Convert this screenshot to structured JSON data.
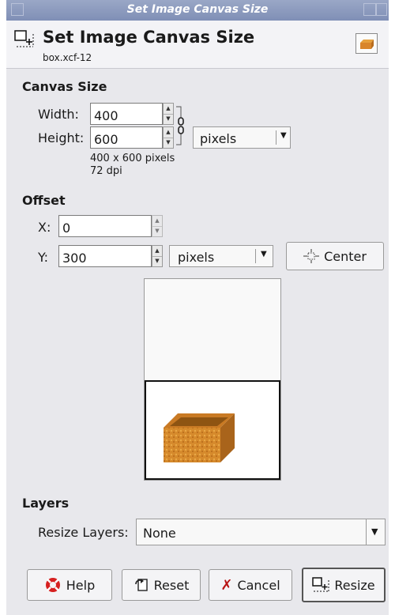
{
  "window": {
    "title": "Set Image Canvas Size"
  },
  "header": {
    "title": "Set Image Canvas Size",
    "subtitle": "box.xcf-12"
  },
  "canvas_size": {
    "section_label": "Canvas Size",
    "width_label": "Width:",
    "width_value": "400",
    "height_label": "Height:",
    "height_value": "600",
    "unit": "pixels",
    "size_info": "400 x 600 pixels",
    "dpi_info": "72 dpi"
  },
  "offset": {
    "section_label": "Offset",
    "x_label": "X:",
    "x_value": "0",
    "y_label": "Y:",
    "y_value": "300",
    "unit": "pixels",
    "center_label": "Center"
  },
  "layers": {
    "section_label": "Layers",
    "resize_label": "Resize Layers:",
    "resize_value": "None"
  },
  "buttons": {
    "help": "Help",
    "reset": "Reset",
    "cancel": "Cancel",
    "resize": "Resize"
  },
  "icons": [
    "canvas-size-icon",
    "chain-link-icon",
    "center-icon",
    "help-lifebuoy-icon",
    "reset-icon",
    "cancel-x-icon",
    "resize-icon",
    "image-thumbnail-icon"
  ]
}
